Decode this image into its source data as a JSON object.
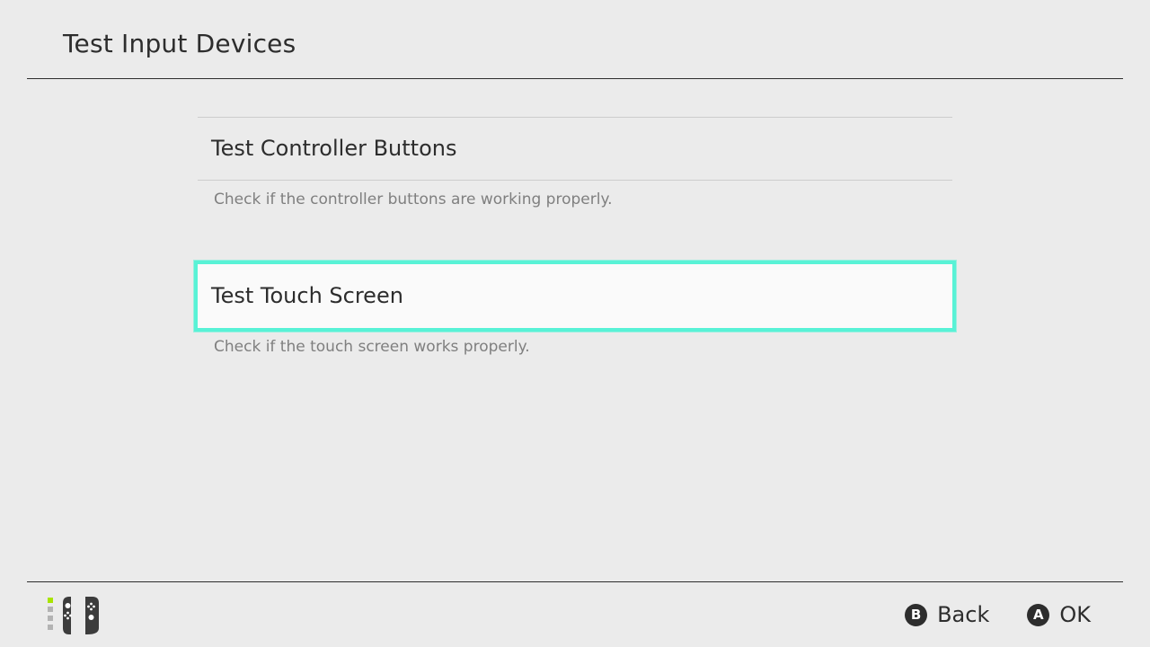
{
  "header": {
    "title": "Test Input Devices"
  },
  "menu": {
    "items": [
      {
        "label": "Test Controller Buttons",
        "description": "Check if the controller buttons are working properly.",
        "selected": false
      },
      {
        "label": "Test Touch Screen",
        "description": "Check if the touch screen works properly.",
        "selected": true
      }
    ]
  },
  "footer": {
    "controller_icon": "joy-con-pair-icon",
    "actions": [
      {
        "glyph": "B",
        "label": "Back"
      },
      {
        "glyph": "A",
        "label": "OK"
      }
    ]
  },
  "colors": {
    "background": "#ebebeb",
    "text": "#2d2d2d",
    "description": "#7f7f7f",
    "selection": "#58f2d6",
    "player_indicator": "#a8e400"
  }
}
